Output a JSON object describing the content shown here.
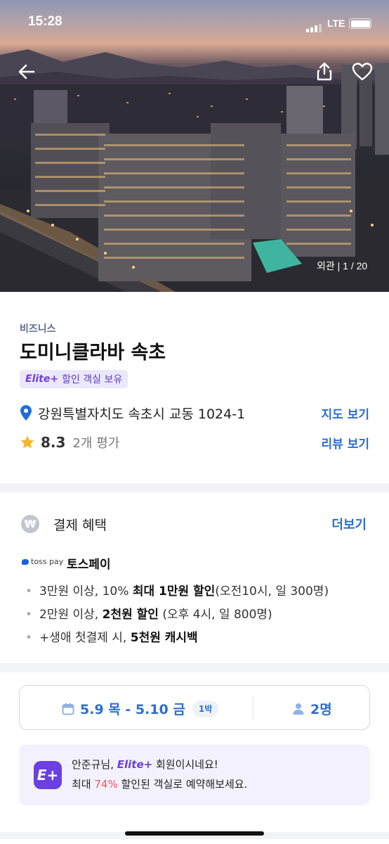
{
  "status_bar": {
    "time": "15:28",
    "network": "LTE"
  },
  "hero": {
    "photo_counter": "외관 | 1 / 20",
    "back_icon": "arrow-left-icon",
    "share_icon": "share-icon",
    "like_icon": "heart-icon"
  },
  "hotel": {
    "category": "비즈니스",
    "name": "도미니클라바 속초",
    "elite_mark": "Elite+",
    "elite_badge": "할인 객실 보유",
    "address": "강원특별자치도 속초시 교동 1024-1",
    "map_link": "지도 보기",
    "rating": "8.3",
    "review_count": "2개 평가",
    "review_link": "리뷰 보기"
  },
  "payment": {
    "title": "결제 혜택",
    "more": "더보기",
    "won_symbol": "₩",
    "provider_logo": "toss pay",
    "provider": "토스페이",
    "benefits": [
      {
        "pre": "3만원 이상, 10% ",
        "bold": "최대 1만원 할인",
        "post": "(오전10시, 일 300명)"
      },
      {
        "pre": "2만원 이상, ",
        "bold": "2천원 할인",
        "post": " (오후 4시, 일 800명)"
      },
      {
        "pre": "+생애 첫결제 시, ",
        "bold": "5천원 캐시백",
        "post": ""
      }
    ]
  },
  "booking": {
    "dates": "5.9 목 - 5.10 금",
    "nights": "1박",
    "guests": "2명"
  },
  "promo": {
    "icon_text": "E+",
    "greeting_pre": "안준규님, ",
    "elite": "Elite+",
    "greeting_post": " 회원이시네요!",
    "line2_pre": "최대 ",
    "discount": "74%",
    "line2_post": " 할인된 객실로 예약해보세요."
  },
  "colors": {
    "accent": "#2c6ed1",
    "elite": "#6b3fe0",
    "discount": "#e65a5a"
  }
}
